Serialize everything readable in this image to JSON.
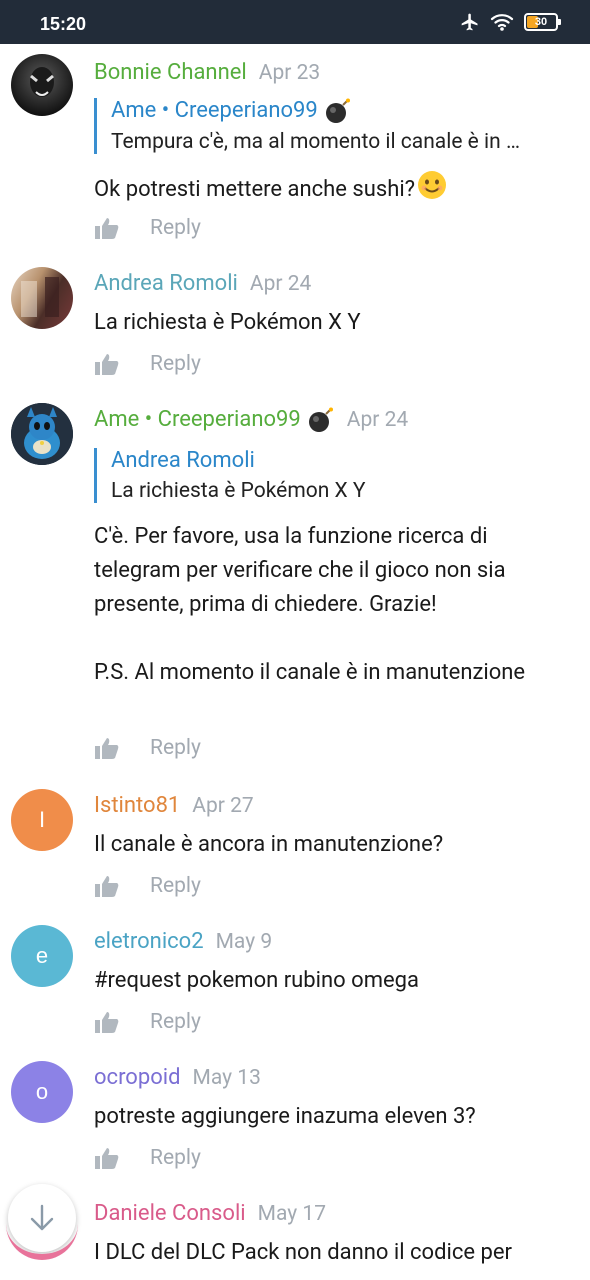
{
  "status": {
    "time": "15:20",
    "battery": "30"
  },
  "comments": [
    {
      "author": "Bonnie Channel",
      "author_color": "#56ad3d",
      "date": "Apr 23",
      "avatar": {
        "type": "photo",
        "bg": "#2b2b2b"
      },
      "quote": {
        "author": "Ame • Creeperiano99",
        "text": "Tempura c'è, ma al momento il canale è in …"
      },
      "text": "Ok potresti mettere anche sushi?",
      "reply": "Reply"
    },
    {
      "author": "Andrea Romoli",
      "author_color": "#5aa6b8",
      "date": "Apr 24",
      "avatar": {
        "type": "photo",
        "bg": "#8a6a5a"
      },
      "text": "La richiesta è Pokémon X Y",
      "reply": "Reply"
    },
    {
      "author": "Ame • Creeperiano99",
      "author_color": "#56ad3d",
      "date": "Apr 24",
      "avatar": {
        "type": "photo",
        "bg": "#2e8fbf"
      },
      "quote": {
        "author": "Andrea Romoli",
        "text": "La richiesta è Pokémon X Y"
      },
      "text": "C'è. Per favore, usa la funzione ricerca di telegram per verificare che il gioco non sia presente, prima di chiedere. Grazie!\n\nP.S. Al momento il canale è in manutenzione",
      "reply": "Reply"
    },
    {
      "author": "Istinto81",
      "author_color": "#e0863c",
      "date": "Apr 27",
      "avatar": {
        "type": "letter",
        "letter": "I",
        "bg": "#f08d4a"
      },
      "text": "Il canale è ancora in manutenzione?",
      "reply": "Reply"
    },
    {
      "author": "eletronico2",
      "author_color": "#4aa3c4",
      "date": "May 9",
      "avatar": {
        "type": "letter",
        "letter": "e",
        "bg": "#5ab8d4"
      },
      "text": "#request pokemon rubino omega",
      "reply": "Reply"
    },
    {
      "author": "ocropoid",
      "author_color": "#7b6fd4",
      "date": "May 13",
      "avatar": {
        "type": "letter",
        "letter": "o",
        "bg": "#8c82e6"
      },
      "text": "potreste aggiungere inazuma eleven 3?",
      "reply": "Reply"
    },
    {
      "author": "Daniele Consoli",
      "author_color": "#d95b8a",
      "date": "May 17",
      "text": "I DLC del DLC Pack non danno il codice per"
    }
  ]
}
